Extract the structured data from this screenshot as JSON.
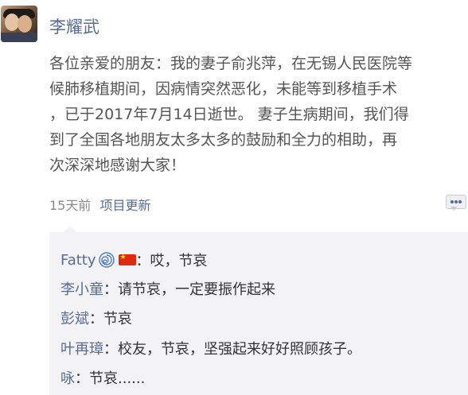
{
  "post": {
    "author": "李耀武",
    "lines": [
      "各位亲爱的朋友：我的妻子俞兆萍，在无锡人民医院等",
      "候肺移植期间，因病情突然恶化，未能等到移植手术",
      "，已于2017年7月14日逝世。 妻子生病期间，我们得",
      "到了全国各地朋友太多太多的鼓励和全力的相助，再",
      "次深深地感谢大家！"
    ],
    "time": "15天前",
    "source": "项目更新"
  },
  "comments": [
    {
      "author": "Fatty",
      "icons": [
        "spiral-icon",
        "china-flag-icon"
      ],
      "text": "：哎，节哀"
    },
    {
      "author": "李小童",
      "text": "：请节哀，一定要振作起来"
    },
    {
      "author": "彭斌",
      "text": "：节哀"
    },
    {
      "author": "叶再璋",
      "text": "：校友，节哀，坚强起来好好照顾孩子。"
    },
    {
      "author": "咏",
      "text": "：节哀......"
    }
  ],
  "colors": {
    "link_blue": "#576b95",
    "body_text": "#555555",
    "comment_bg": "#f3f3f5",
    "flag_red": "#de2910"
  }
}
